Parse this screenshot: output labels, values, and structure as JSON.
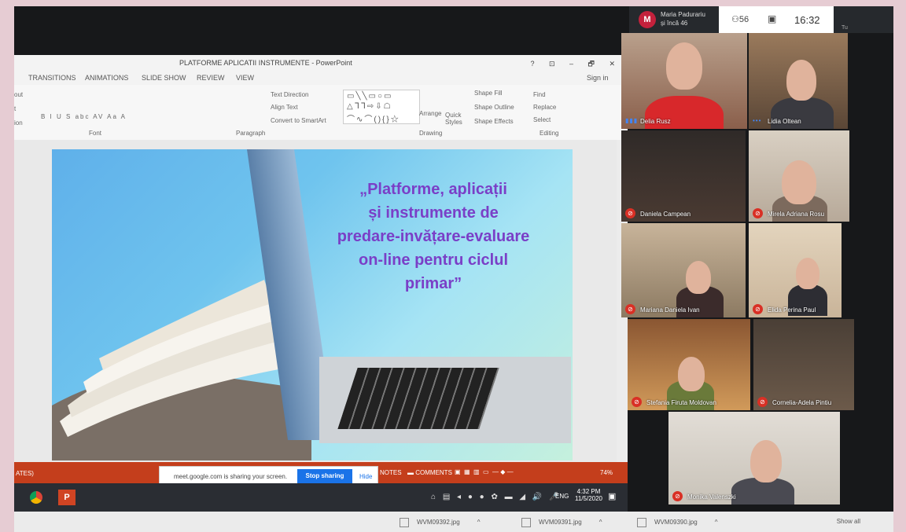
{
  "powerpoint": {
    "window_title": "PLATFORME APLICATII INSTRUMENTE - PowerPoint",
    "window_controls": "? ⊡ – 🗗 ✕",
    "sign_in": "Sign in",
    "tabs": [
      "TRANSITIONS",
      "ANIMATIONS",
      "SLIDE SHOW",
      "REVIEW",
      "VIEW"
    ],
    "ribbon": {
      "font_group": "Font",
      "paragraph_group": "Paragraph",
      "drawing_group": "Drawing",
      "editing_group": "Editing",
      "text_direction": "Text Direction",
      "align_text": "Align Text",
      "convert_smartart": "Convert to SmartArt",
      "arrange": "Arrange",
      "quick_styles": "Quick Styles",
      "shape_fill": "Shape Fill",
      "shape_outline": "Shape Outline",
      "shape_effects": "Shape Effects",
      "find": "Find",
      "replace": "Replace",
      "select": "Select",
      "font_buttons": "B I U S abc AV Aa A",
      "side_labels": [
        "out",
        "t",
        "ion"
      ]
    },
    "slide": {
      "title_lines": [
        "„Platforme, aplicații",
        "și instrumente de",
        "predare-invățare-evaluare",
        "on-line  pentru ciclul",
        "primar”"
      ]
    },
    "status": {
      "notes": "NOTES",
      "comments": "COMMENTS",
      "zoom": "74%",
      "left_text": "ATES)"
    }
  },
  "screen_share": {
    "message": "meet.google.com is sharing your screen.",
    "stop_button": "Stop sharing",
    "hide_button": "Hide"
  },
  "taskbar": {
    "powerpoint_label": "P",
    "tray_icons": "⌂ ▤ ◂ ● ● ✿ ▬ ◢ 🔊 🎤",
    "language": "ENG",
    "time": "4:32 PM",
    "date": "11/5/2020"
  },
  "downloads": [
    {
      "name": "WVM09392.jpg"
    },
    {
      "name": "WVM09391.jpg"
    },
    {
      "name": "WVM09390.jpg"
    }
  ],
  "downloads_show_all": "Show all",
  "meet": {
    "host_initial": "M",
    "host_name": "Maria Padurariu",
    "host_sub": "și încă 46",
    "people_count": "⚇56",
    "chat_icon_label": "▣",
    "time": "16:32",
    "tu_label": "Tu",
    "participants": [
      {
        "name": "Delia Rusz",
        "muted": false
      },
      {
        "name": "Lidia Oltean",
        "muted": false
      },
      {
        "name": "Daniela Campean",
        "muted": true
      },
      {
        "name": "Mirela Adriana Rosu",
        "muted": true
      },
      {
        "name": "Mariana Daniela Ivan",
        "muted": true
      },
      {
        "name": "Elida Perina Paul",
        "muted": true
      },
      {
        "name": "Stefania Firuta Moldovan",
        "muted": true
      },
      {
        "name": "Cornelia-Adela Pintiu",
        "muted": true
      },
      {
        "name": "Monika Valenszki",
        "muted": true
      }
    ]
  },
  "colors": {
    "powerpoint_accent": "#c43e1c",
    "slide_text": "#7a3fc7",
    "meet_stop_button": "#1a73e8",
    "mute_badge": "#d93025",
    "host_avatar": "#c4213c"
  }
}
